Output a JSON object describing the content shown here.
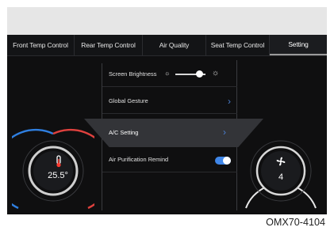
{
  "tabs": [
    {
      "label": "Front Temp Control",
      "active": false
    },
    {
      "label": "Rear Temp Control",
      "active": false
    },
    {
      "label": "Air Quality",
      "active": false
    },
    {
      "label": "Seat Temp Control",
      "active": false
    },
    {
      "label": "Setting",
      "active": true
    }
  ],
  "settings": {
    "brightness_label": "Screen Brightness",
    "brightness_level": 0.8,
    "gesture_label": "Global Gesture",
    "ac_label": "A/C Setting",
    "purification_label": "Air Purification Remind",
    "purification_on": true
  },
  "left_gauge": {
    "value": "25.5°",
    "icon": "thermometer-icon"
  },
  "right_gauge": {
    "value": "4",
    "icon": "fan-icon"
  },
  "caption": "OMX70-4104",
  "colors": {
    "accent_blue": "#3f86e8",
    "warm_red": "#e0413e",
    "cool_blue": "#2f7fe0"
  }
}
